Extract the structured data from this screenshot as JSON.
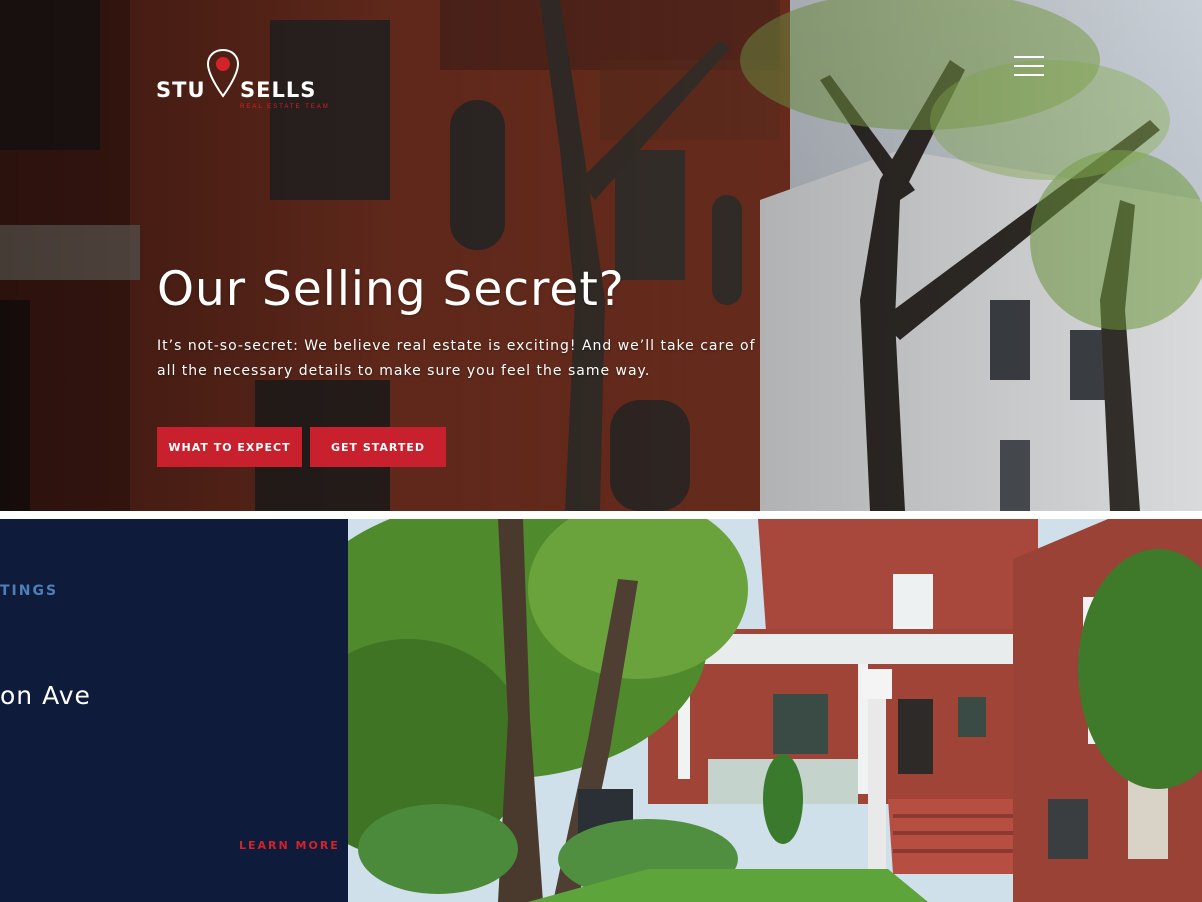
{
  "header": {
    "logo": {
      "word_left": "STU",
      "word_right": "SELLS",
      "tagline": "REAL ESTATE TEAM"
    },
    "menu_icon": "hamburger-menu-icon"
  },
  "hero": {
    "title": "Our Selling Secret?",
    "description": "It’s not-so-secret: We believe real estate is exciting! And we’ll take care of all the necessary details to make sure you feel the same way.",
    "buttons": {
      "what_to_expect": "WHAT TO EXPECT",
      "get_started": "GET STARTED"
    }
  },
  "listing": {
    "eyebrow": "TINGS",
    "address": "on Ave",
    "learn_more": "LEARN MORE",
    "learn_more_icon": "arrow-circle-icon"
  },
  "colors": {
    "accent_red": "#c8202c",
    "navy": "#0f1b3a",
    "eyebrow_blue": "#4d7fb8"
  }
}
